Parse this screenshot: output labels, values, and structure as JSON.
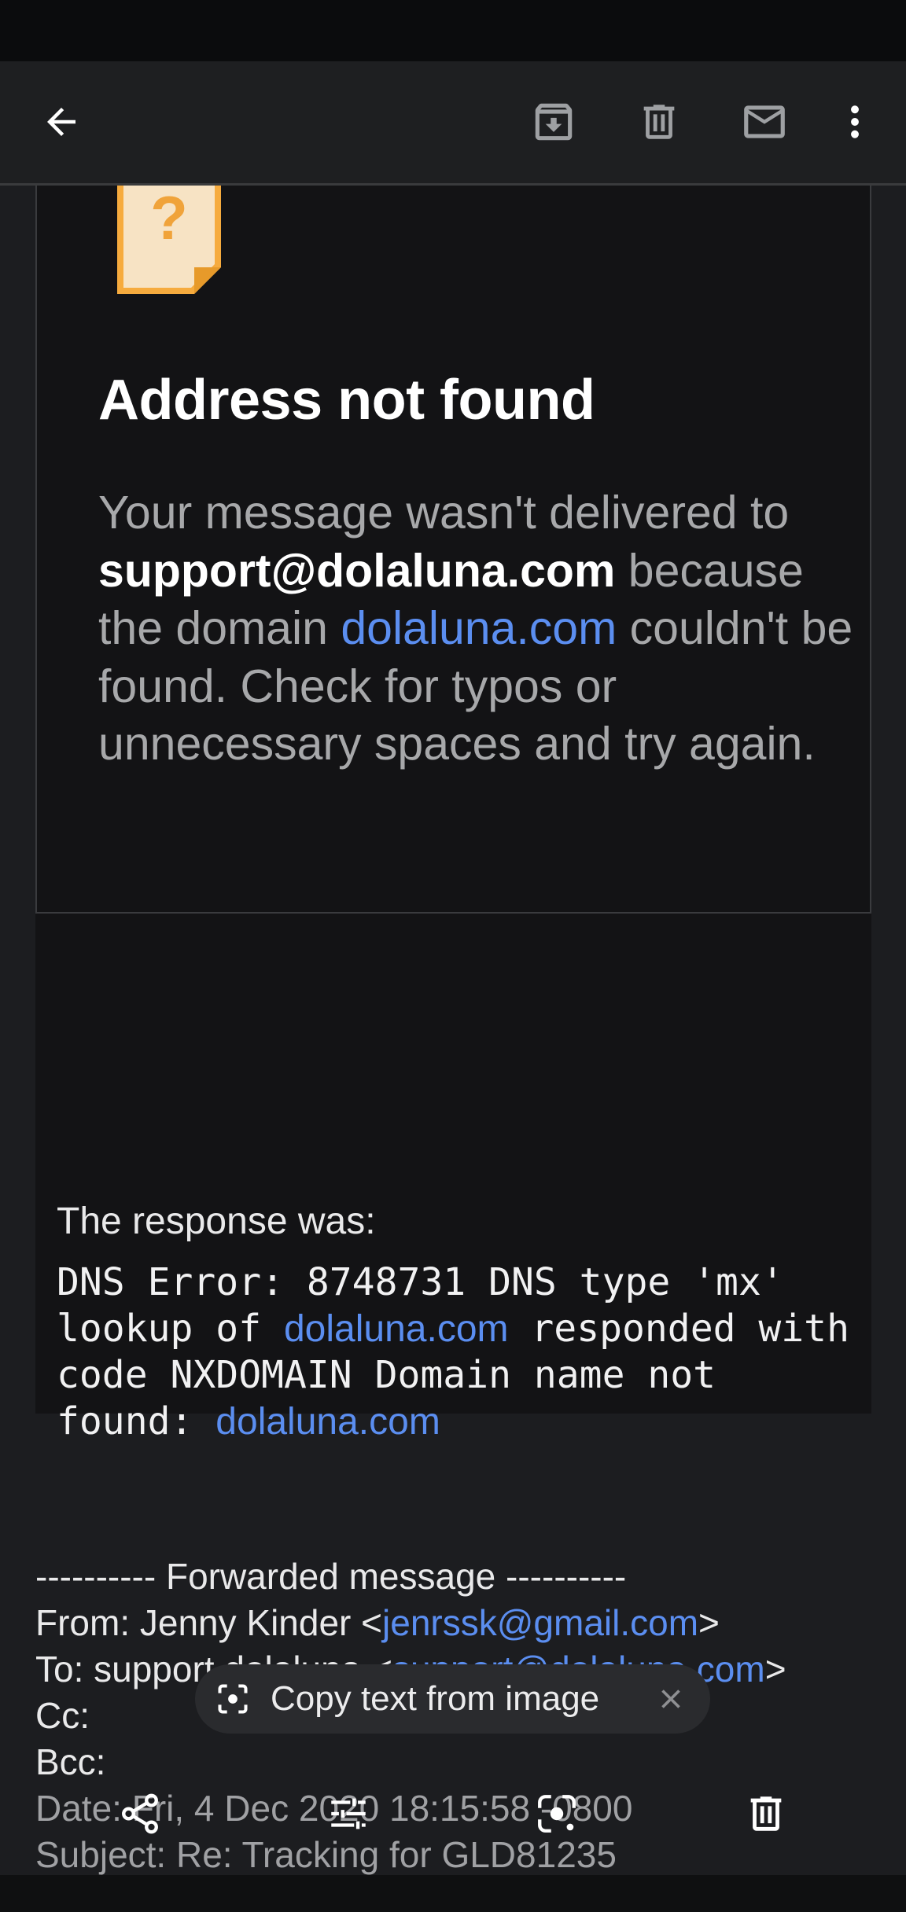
{
  "app_bar": {
    "back_icon": "arrow-left-icon",
    "actions": [
      "archive-icon",
      "delete-icon",
      "mark-unread-icon",
      "more-vert-icon"
    ]
  },
  "bounce": {
    "title": "Address not found",
    "msg_part1": "Your message wasn't delivered to ",
    "recipient": "support@dolaluna.com",
    "msg_part2": " because the domain ",
    "domain_link": "dolaluna.com",
    "msg_part3": " couldn't be found. Check for typos or unnecessary spaces and try again."
  },
  "response": {
    "label": "The response was:",
    "error_part1": "DNS Error: 8748731 DNS type 'mx' lookup of ",
    "error_link1": "dolaluna.com",
    "error_part2": " responded with code NXDOMAIN Domain name not found: ",
    "error_link2": "dolaluna.com"
  },
  "forwarded": {
    "header": "---------- Forwarded message ----------",
    "from_label": "From: Jenny Kinder <",
    "from_email": "jenrssk@gmail.com",
    "from_end": ">",
    "to_label": "To: support dolaluna <",
    "to_email": "support@dolaluna.com",
    "to_end": ">",
    "cc": "Cc:",
    "bcc": "Bcc:",
    "date": "Date: Fri, 4 Dec 2020 18:15:58 -0800",
    "subject": "Subject: Re: Tracking for GLD81235"
  },
  "copy_chip": {
    "label": "Copy text from image"
  },
  "bottom_toolbar": [
    "share-icon",
    "edit-adjust-icon",
    "lens-icon",
    "delete-icon"
  ],
  "colors": {
    "accent_link": "#5b8ef0",
    "doc_icon": "#f6ab3e"
  }
}
